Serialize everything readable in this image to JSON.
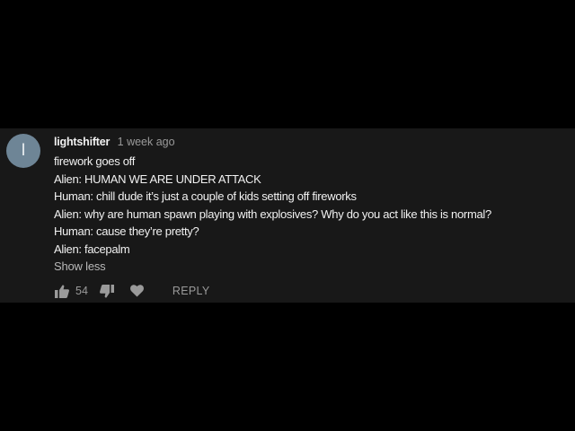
{
  "comment": {
    "avatar_letter": "I",
    "author": "lightshifter",
    "timestamp": "1 week ago",
    "lines": [
      "firework goes off",
      "Alien: HUMAN WE ARE UNDER ATTACK",
      "Human: chill dude it’s just a couple of kids setting off fireworks",
      "Alien: why are human spawn playing with explosives? Why do you act like this is normal?",
      "Human: cause they’re pretty?",
      "Alien: facepalm"
    ],
    "show_less_label": "Show less"
  },
  "actions": {
    "like_icon": "thumbs-up-icon",
    "like_count": "54",
    "dislike_icon": "thumbs-down-icon",
    "heart_icon": "heart-icon",
    "reply_label": "REPLY"
  },
  "colors": {
    "background": "#000000",
    "panel": "#181818",
    "avatar": "#6e8596",
    "primary_text": "#f1f1f1",
    "secondary_text": "#9a9a9a"
  }
}
